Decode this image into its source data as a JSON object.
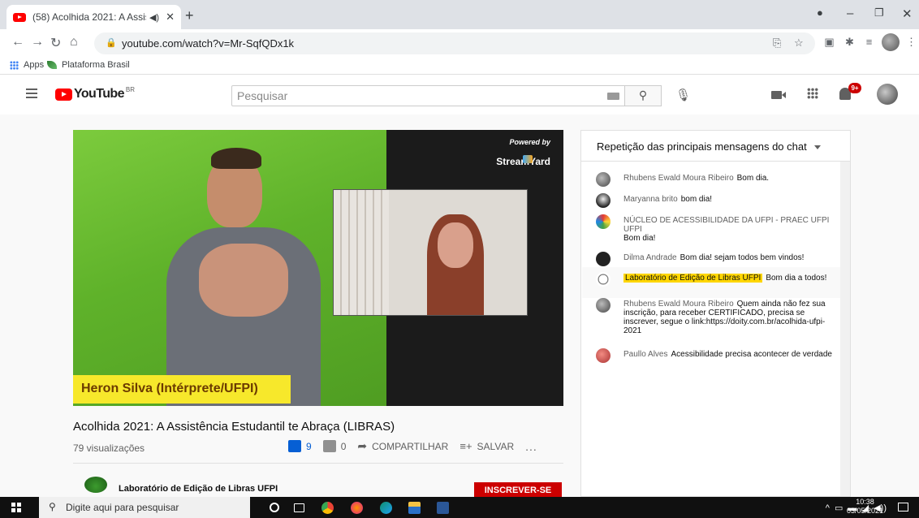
{
  "browser": {
    "tab_title": "(58) Acolhida 2021: A Assistê",
    "new_tab": "+",
    "url": "youtube.com/watch?v=Mr-SqfQDx1k",
    "bookmarks": [
      "Apps",
      "Plataforma Brasil"
    ]
  },
  "youtube": {
    "logo": "YouTube",
    "region": "BR",
    "search_placeholder": "Pesquisar",
    "notifications": "9+"
  },
  "video": {
    "overlay_name": "Heron Silva (Intérprete/UFPI)",
    "powered_by": "Powered by",
    "streamyard": "StreamYard",
    "title": "Acolhida 2021: A Assistência Estudantil te Abraça (LIBRAS)",
    "views": "79 visualizações",
    "likes": "9",
    "dislikes": "0",
    "share": "COMPARTILHAR",
    "save": "SALVAR",
    "more": "...",
    "channel": "Laboratório de Edição de Libras UFPI",
    "subscribe": "INSCREVER-SE"
  },
  "chat": {
    "header": "Repetição das principais mensagens do chat",
    "messages": [
      {
        "author": "Rhubens Ewald Moura Ribeiro",
        "text": "Bom dia."
      },
      {
        "author": "Maryanna brito",
        "text": "bom dia!"
      },
      {
        "author": "NÚCLEO DE ACESSIBILIDADE DA UFPI - PRAEC UFPI UFPI",
        "text": "Bom dia!"
      },
      {
        "author": "Dilma Andrade",
        "text": "Bom dia! sejam todos bem vindos!"
      },
      {
        "author": "Laboratório de Edição de Libras UFPI",
        "text": "Bom dia a todos!"
      },
      {
        "author": "Rhubens Ewald Moura Ribeiro",
        "text": "Quem ainda não fez sua inscrição, para receber CERTIFICADO, precisa se inscrever, segue o link:https://doity.com.br/acolhida-ufpi-2021"
      },
      {
        "author": "Paullo Alves",
        "text": "Acessibilidade precisa acontecer de verdade"
      }
    ]
  },
  "taskbar": {
    "search_placeholder": "Digite aqui para pesquisar",
    "time": "10:38",
    "date": "03/05/2021"
  },
  "colors": {
    "youtube_red": "#ff0000",
    "highlight_yellow": "#ffd600",
    "like_blue": "#065fd4",
    "banner_yellow": "#f7e82b"
  }
}
